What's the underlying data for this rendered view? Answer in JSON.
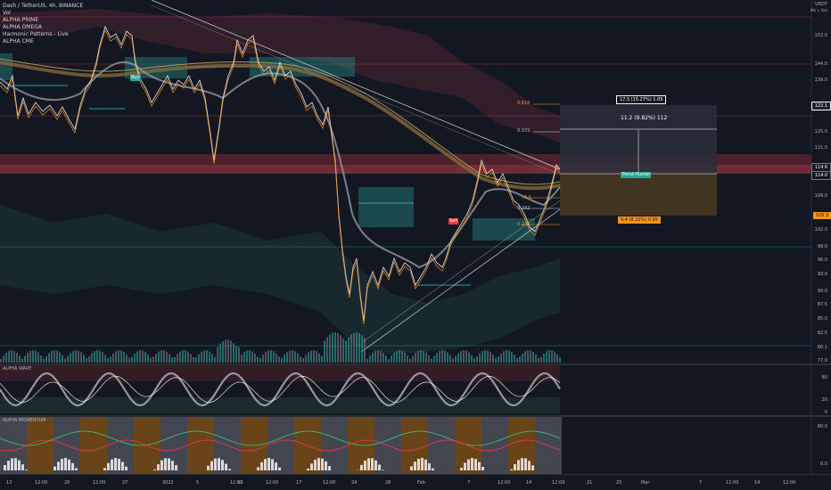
{
  "header": {
    "symbol_line": "Dash / TetherUS, 4h, BINANCE",
    "currency": "USDT",
    "currency_sub": "Mo ↓ (to)",
    "indicators": [
      "Vol",
      "ALPHA PRIME",
      "ALPHA OMEGA",
      "Harmonic Patterns - Live",
      "ALPHA CME"
    ]
  },
  "price_axis": {
    "ticks": [
      "152.0",
      "144.0",
      "139.0",
      "125.0",
      "121.0",
      "114.6",
      "109.0",
      "102.0",
      "99.0",
      "96.0",
      "93.0",
      "90.0",
      "87.5",
      "85.0",
      "82.5",
      "80.1",
      "77.9"
    ],
    "current_price_tags": [
      {
        "text": "122.1",
        "color": "#ffffff",
        "bg": "#1e222d",
        "border": "#ffffff"
      },
      {
        "text": "114.6",
        "color": "#ffffff",
        "bg": "#131722",
        "border": "#787b86"
      },
      {
        "text": "114.0",
        "color": "#ffffff",
        "bg": "#131722",
        "border": "#787b86"
      },
      {
        "text": "105.3",
        "color": "#131722",
        "bg": "#f7931a",
        "border": "#f7931a"
      }
    ]
  },
  "time_axis": {
    "ticks": [
      "13",
      "12:00",
      "20",
      "12:00",
      "27",
      "2022",
      "5",
      "12:00",
      "10",
      "12:00",
      "17",
      "12:00",
      "24",
      "28",
      "Feb",
      "7",
      "12:00",
      "14",
      "12:00",
      "21",
      "25",
      "Mar",
      "7",
      "12:00",
      "14",
      "12:00"
    ]
  },
  "fib_levels": [
    {
      "label": "0.618"
    },
    {
      "label": "0.372"
    },
    {
      "label": "0.5"
    },
    {
      "label": "0.382"
    },
    {
      "label": "0.236"
    }
  ],
  "position_tool": {
    "target_label": "17.5 (15.27%) 1.09",
    "mid_label": "11.2 (9.82%) 112",
    "stop_label": "9.4 (8.22%) 0.95",
    "target_color": "#ffffff",
    "stop_color": "#f7931a"
  },
  "markers": {
    "buy_label": "Buy",
    "sell_label": "Sell",
    "trend_label": "Trend Hunter"
  },
  "panes": {
    "wave_title": "ALPHA WAVE",
    "wave_ticks": [
      "80",
      "20",
      "0"
    ],
    "momentum_title": "ALPHA MOMENTUM",
    "momentum_ticks": [
      "80.0",
      "0.0"
    ]
  },
  "colors": {
    "bg": "#131722",
    "accent_orange": "#f7931a",
    "accent_teal": "#26a69a",
    "bear_red": "#f23645",
    "white": "#ffffff"
  }
}
